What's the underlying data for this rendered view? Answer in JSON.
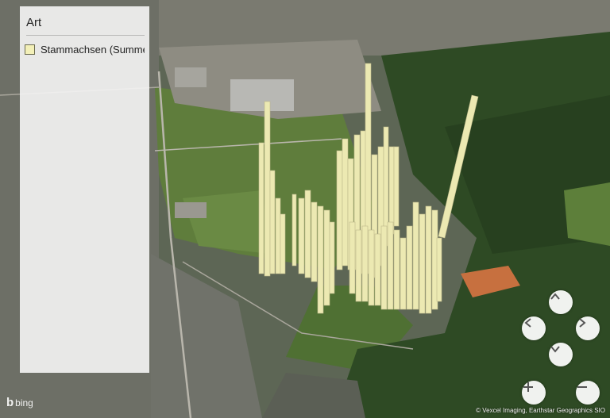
{
  "legend": {
    "title": "Art",
    "items": [
      {
        "label": "Stammachsen (Summe",
        "color": "#f3f0b8"
      }
    ]
  },
  "controls": {
    "pan_up": "pan-up",
    "pan_left": "pan-left",
    "pan_right": "pan-right",
    "pan_down": "pan-down",
    "zoom_in": "+",
    "zoom_out": "−"
  },
  "branding": {
    "logo_text": "bing"
  },
  "attribution": "© Vexcel Imaging, Earthstar Geographics  SIO",
  "colors": {
    "column_fill": "#ece9b2",
    "column_side": "#c9c58c",
    "forest": "#2f4a24",
    "field": "#5b7a3a"
  }
}
